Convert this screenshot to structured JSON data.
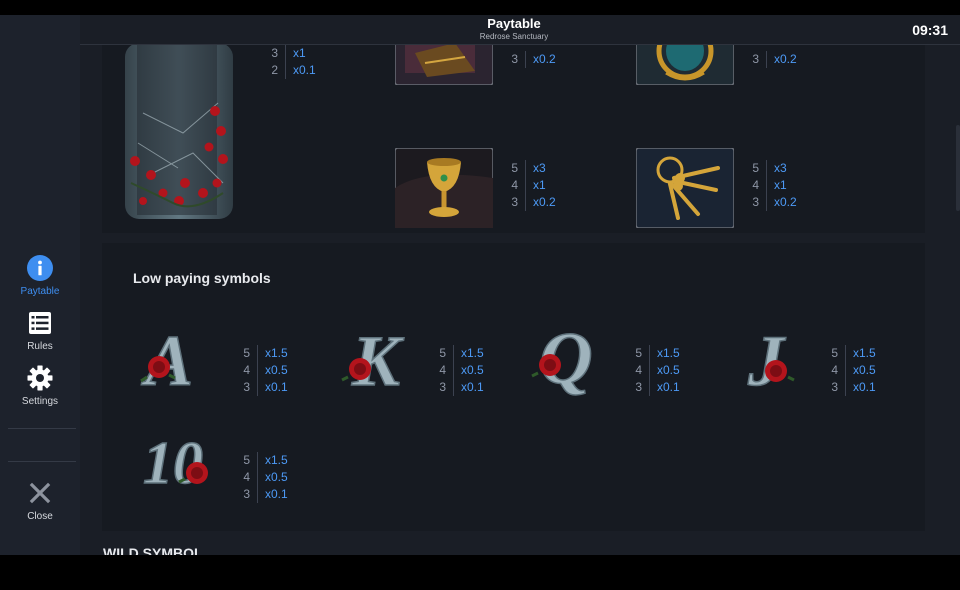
{
  "header": {
    "title": "Paytable",
    "subtitle": "Redrose Sanctuary",
    "clock": "09:31"
  },
  "sidebar": {
    "items": [
      {
        "label": "Paytable",
        "icon": "info-icon",
        "active": true
      },
      {
        "label": "Rules",
        "icon": "list-icon",
        "active": false
      },
      {
        "label": "Settings",
        "icon": "gear-icon",
        "active": false
      },
      {
        "label": "Close",
        "icon": "close-icon",
        "active": false
      }
    ]
  },
  "high_symbols": {
    "vial": {
      "icon": "vial-roses-symbol",
      "pays": [
        {
          "count": "3",
          "value": "x1"
        },
        {
          "count": "2",
          "value": "x0.1"
        }
      ]
    },
    "book": {
      "icon": "book-symbol",
      "pays": [
        {
          "count": "3",
          "value": "x0.2"
        }
      ]
    },
    "mirror": {
      "icon": "mirror-symbol",
      "pays": [
        {
          "count": "3",
          "value": "x0.2"
        }
      ]
    },
    "chalice": {
      "icon": "chalice-symbol",
      "pays": [
        {
          "count": "5",
          "value": "x3"
        },
        {
          "count": "4",
          "value": "x1"
        },
        {
          "count": "3",
          "value": "x0.2"
        }
      ]
    },
    "keys": {
      "icon": "keys-symbol",
      "pays": [
        {
          "count": "5",
          "value": "x3"
        },
        {
          "count": "4",
          "value": "x1"
        },
        {
          "count": "3",
          "value": "x0.2"
        }
      ]
    }
  },
  "low_section": {
    "title": "Low paying symbols",
    "symbols": [
      {
        "letter": "A",
        "pays": [
          {
            "count": "5",
            "value": "x1.5"
          },
          {
            "count": "4",
            "value": "x0.5"
          },
          {
            "count": "3",
            "value": "x0.1"
          }
        ]
      },
      {
        "letter": "K",
        "pays": [
          {
            "count": "5",
            "value": "x1.5"
          },
          {
            "count": "4",
            "value": "x0.5"
          },
          {
            "count": "3",
            "value": "x0.1"
          }
        ]
      },
      {
        "letter": "Q",
        "pays": [
          {
            "count": "5",
            "value": "x1.5"
          },
          {
            "count": "4",
            "value": "x0.5"
          },
          {
            "count": "3",
            "value": "x0.1"
          }
        ]
      },
      {
        "letter": "J",
        "pays": [
          {
            "count": "5",
            "value": "x1.5"
          },
          {
            "count": "4",
            "value": "x0.5"
          },
          {
            "count": "3",
            "value": "x0.1"
          }
        ]
      },
      {
        "letter": "10",
        "pays": [
          {
            "count": "5",
            "value": "x1.5"
          },
          {
            "count": "4",
            "value": "x0.5"
          },
          {
            "count": "3",
            "value": "x0.1"
          }
        ]
      }
    ]
  },
  "wild_section": {
    "title": "WILD SYMBOL"
  },
  "colors": {
    "accent": "#3e8ef0",
    "payout": "#4d9af6",
    "rose": "#b3141c"
  }
}
